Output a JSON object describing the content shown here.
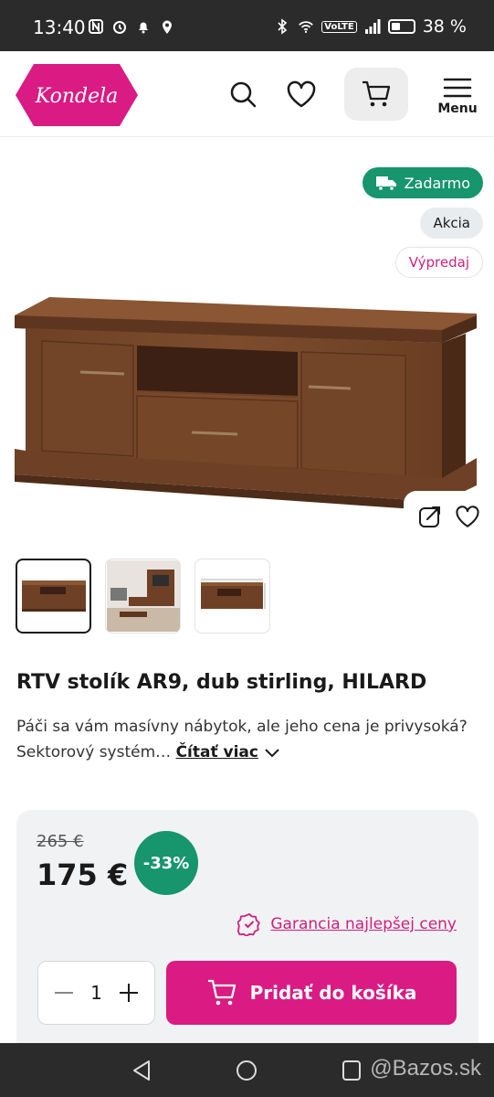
{
  "status_bar": {
    "time": "13:40",
    "volte": "VoLTE",
    "battery": "38 %"
  },
  "header": {
    "logo_text": "Kondela",
    "menu_label": "Menu",
    "brand_color": "#d91b83"
  },
  "badges": {
    "free_shipping": "Zadarmo",
    "sale": "Akcia",
    "clearance": "Výpredaj"
  },
  "product": {
    "title": "RTV stolík AR9, dub stirling, HILARD",
    "description": "Páči sa vám masívny nábytok, ale jeho cena je privysoká? Sektorový systém…",
    "read_more": "Čítať viac",
    "thumbnails": [
      "thumb-front",
      "thumb-room",
      "thumb-dimensions"
    ]
  },
  "pricing": {
    "old_price": "265 €",
    "new_price": "175 €",
    "discount": "-33%",
    "guarantee": "Garancia najlepšej ceny",
    "quantity": "1",
    "add_to_cart": "Pridať do košíka"
  },
  "watermark": "@Bazos.sk",
  "icons": [
    "search-icon",
    "heart-icon",
    "cart-icon",
    "hamburger-icon",
    "truck-icon",
    "share-icon",
    "seal-check-icon",
    "minus-icon",
    "plus-icon"
  ]
}
